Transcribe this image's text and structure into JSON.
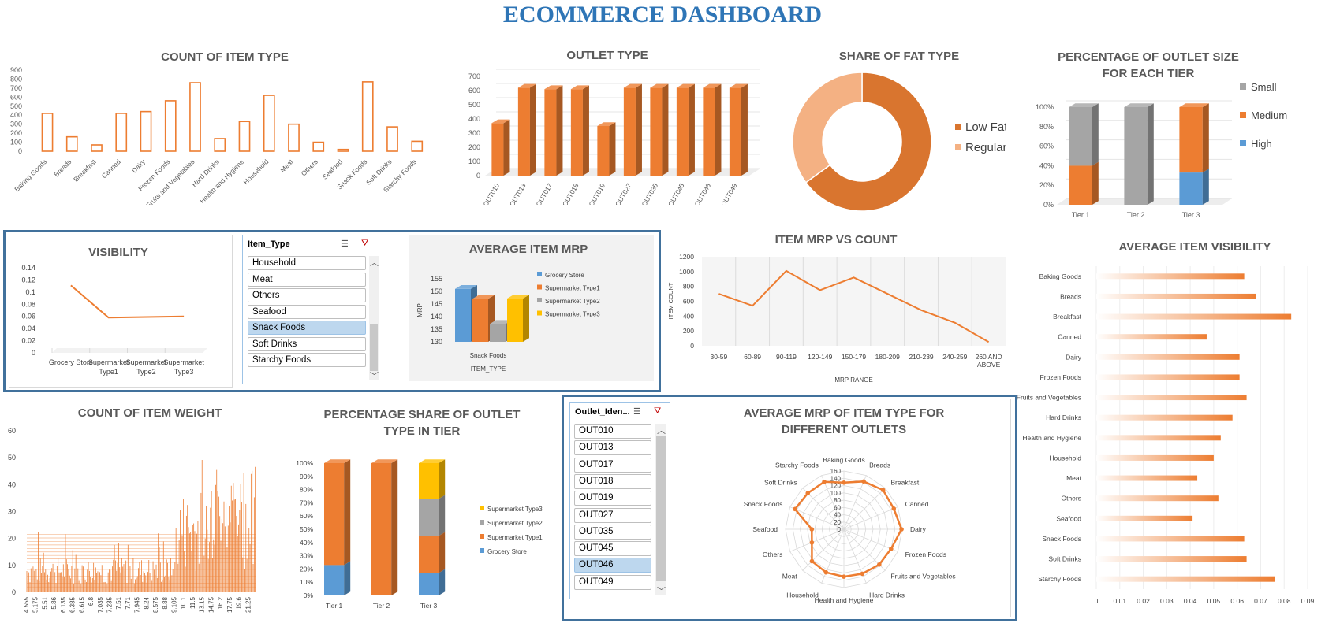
{
  "dashboard": {
    "title": "ECOMMERCE DASHBOARD"
  },
  "colors": {
    "orange": "#ED7D31",
    "blue": "#5B9BD5",
    "gray": "#A5A5A5",
    "yellow": "#FFC000",
    "peach": "#F4B183",
    "dark_orange": "#D9752F",
    "title_blue": "#2E75B6",
    "frame_blue": "#41719C"
  },
  "chart_data": [
    {
      "id": "count_item_type",
      "type": "bar",
      "title": "COUNT OF ITEM TYPE",
      "categories": [
        "Baking Goods",
        "Breads",
        "Breakfast",
        "Canned",
        "Dairy",
        "Frozen Foods",
        "Fruits and Vegetables",
        "Hard Drinks",
        "Health and Hygiene",
        "Household",
        "Meat",
        "Others",
        "Seafood",
        "Snack Foods",
        "Soft Drinks",
        "Starchy Foods"
      ],
      "values": [
        420,
        160,
        70,
        420,
        440,
        560,
        760,
        140,
        330,
        620,
        300,
        100,
        20,
        770,
        270,
        110
      ],
      "ylim": [
        0,
        900
      ],
      "yticks": [
        "0",
        "100",
        "200",
        "300",
        "400",
        "500",
        "600",
        "700",
        "800",
        "900"
      ]
    },
    {
      "id": "outlet_type",
      "type": "bar",
      "title": "OUTLET TYPE",
      "categories": [
        "OUT010",
        "OUT013",
        "OUT017",
        "OUT018",
        "OUT019",
        "OUT027",
        "OUT035",
        "OUT045",
        "OUT046",
        "OUT049"
      ],
      "values": [
        370,
        620,
        610,
        610,
        350,
        620,
        620,
        620,
        620,
        620
      ],
      "ylim": [
        0,
        700
      ],
      "yticks": [
        "0",
        "100",
        "200",
        "300",
        "400",
        "500",
        "600",
        "700"
      ]
    },
    {
      "id": "fat_type",
      "type": "pie",
      "title": "SHARE OF FAT TYPE",
      "labels": [
        "Low Fat",
        "Regular"
      ],
      "values": [
        65,
        35
      ]
    },
    {
      "id": "outlet_size_tier",
      "type": "bar",
      "title": "PERCENTAGE OF OUTLET SIZE FOR EACH TIER",
      "categories": [
        "Tier 1",
        "Tier 2",
        "Tier 3"
      ],
      "series": [
        {
          "name": "High",
          "values": [
            0,
            0,
            33
          ]
        },
        {
          "name": "Medium",
          "values": [
            40,
            0,
            67
          ]
        },
        {
          "name": "Small",
          "values": [
            60,
            100,
            0
          ]
        }
      ],
      "legend": [
        "Small",
        "Medium",
        "High"
      ],
      "yticks": [
        "0%",
        "20%",
        "40%",
        "60%",
        "80%",
        "100%"
      ]
    },
    {
      "id": "visibility",
      "type": "line",
      "title": "VISIBILITY",
      "categories": [
        "Grocery Store",
        "Supermarket Type1",
        "Supermarket Type2",
        "Supermarket Type3"
      ],
      "values": [
        0.111,
        0.058,
        0.059,
        0.06
      ],
      "ylim": [
        0,
        0.14
      ],
      "yticks": [
        "0",
        "0.02",
        "0.04",
        "0.06",
        "0.08",
        "0.1",
        "0.12",
        "0.14"
      ]
    },
    {
      "id": "avg_item_mrp",
      "type": "bar",
      "title": "AVERAGE ITEM MRP",
      "categories": [
        "Snack Foods"
      ],
      "series": [
        {
          "name": "Grocery Store",
          "values": [
            151
          ]
        },
        {
          "name": "Supermarket Type1",
          "values": [
            148
          ]
        },
        {
          "name": "Supermarket Type2",
          "values": [
            139
          ]
        },
        {
          "name": "Supermarket Type3",
          "values": [
            150
          ]
        }
      ],
      "xlabel": "ITEM_TYPE",
      "ylabel": "MRP",
      "ylim": [
        130,
        155
      ],
      "yticks": [
        "130",
        "135",
        "140",
        "145",
        "150",
        "155"
      ]
    },
    {
      "id": "mrp_vs_count",
      "type": "line",
      "title": "ITEM MRP VS COUNT",
      "categories": [
        "30-59",
        "60-89",
        "90-119",
        "120-149",
        "150-179",
        "180-209",
        "210-239",
        "240-259",
        "260 AND ABOVE"
      ],
      "values": [
        700,
        540,
        1010,
        750,
        920,
        700,
        480,
        310,
        50
      ],
      "xlabel": "MRP RANGE",
      "ylabel": "ITEM COUNT",
      "ylim": [
        0,
        1200
      ],
      "yticks": [
        "0",
        "200",
        "400",
        "600",
        "800",
        "1000",
        "1200"
      ]
    },
    {
      "id": "avg_visibility",
      "type": "bar",
      "title": "AVERAGE ITEM VISIBILITY",
      "categories": [
        "Baking Goods",
        "Breads",
        "Breakfast",
        "Canned",
        "Dairy",
        "Frozen Foods",
        "Fruits and Vegetables",
        "Hard Drinks",
        "Health and Hygiene",
        "Household",
        "Meat",
        "Others",
        "Seafood",
        "Snack Foods",
        "Soft Drinks",
        "Starchy Foods"
      ],
      "values": [
        0.063,
        0.068,
        0.083,
        0.047,
        0.061,
        0.061,
        0.064,
        0.058,
        0.053,
        0.05,
        0.043,
        0.052,
        0.041,
        0.063,
        0.064,
        0.076
      ],
      "xlim": [
        0,
        0.09
      ],
      "xticks": [
        "0",
        "0.01",
        "0.02",
        "0.03",
        "0.04",
        "0.05",
        "0.06",
        "0.07",
        "0.08",
        "0.09"
      ]
    },
    {
      "id": "count_item_weight",
      "type": "bar",
      "title": "COUNT OF ITEM WEIGHT",
      "xticks": [
        "4.555",
        "5.175",
        "5.51",
        "5.86",
        "6.135",
        "6.385",
        "6.615",
        "6.8",
        "7.035",
        "7.235",
        "7.51",
        "7.71",
        "7.945",
        "8.24",
        "8.575",
        "8.88",
        "9.105",
        "10.1",
        "11.5",
        "13.15",
        "14.75",
        "16.2",
        "17.75",
        "19.6",
        "21.25"
      ],
      "ylim": [
        0,
        60
      ],
      "yticks": [
        "0",
        "10",
        "20",
        "30",
        "40",
        "50",
        "60"
      ]
    },
    {
      "id": "outlet_type_tier",
      "type": "bar",
      "title": "PERCENTAGE SHARE OF OUTLET TYPE IN TIER",
      "categories": [
        "Tier 1",
        "Tier 2",
        "Tier 3"
      ],
      "series": [
        {
          "name": "Grocery Store",
          "values": [
            23,
            0,
            17
          ]
        },
        {
          "name": "Supermarket Type1",
          "values": [
            77,
            100,
            28
          ]
        },
        {
          "name": "Supermarket Type2",
          "values": [
            0,
            0,
            28
          ]
        },
        {
          "name": "Supermarket Type3",
          "values": [
            0,
            0,
            27
          ]
        }
      ],
      "legend": [
        "Supermarket Type3",
        "Supermarket Type2",
        "Supermarket Type1",
        "Grocery Store"
      ],
      "yticks": [
        "0%",
        "10%",
        "20%",
        "30%",
        "40%",
        "50%",
        "60%",
        "70%",
        "80%",
        "90%",
        "100%"
      ]
    },
    {
      "id": "avg_mrp_radar",
      "type": "line",
      "title": "AVERAGE MRP OF ITEM TYPE FOR DIFFERENT OUTLETS",
      "categories": [
        "Baking Goods",
        "Breads",
        "Breakfast",
        "Canned",
        "Dairy",
        "Frozen Foods",
        "Fruits and Vegetables",
        "Hard Drinks",
        "Health and Hygiene",
        "Household",
        "Meat",
        "Others",
        "Seafood",
        "Snack Foods",
        "Soft Drinks",
        "Starchy Foods"
      ],
      "values": [
        128,
        142,
        152,
        148,
        158,
        140,
        137,
        132,
        130,
        128,
        124,
        95,
        88,
        145,
        140,
        141
      ],
      "rlim": [
        0,
        160
      ],
      "rticks": [
        "0",
        "20",
        "40",
        "60",
        "80",
        "100",
        "120",
        "140",
        "160"
      ]
    }
  ],
  "item_type_slicer": {
    "header": "Item_Type",
    "items": [
      "Household",
      "Meat",
      "Others",
      "Seafood",
      "Snack Foods",
      "Soft Drinks",
      "Starchy Foods"
    ],
    "selected": "Snack Foods"
  },
  "outlet_slicer": {
    "header": "Outlet_Iden...",
    "items": [
      "OUT010",
      "OUT013",
      "OUT017",
      "OUT018",
      "OUT019",
      "OUT027",
      "OUT035",
      "OUT045",
      "OUT046",
      "OUT049"
    ],
    "selected": "OUT046"
  }
}
